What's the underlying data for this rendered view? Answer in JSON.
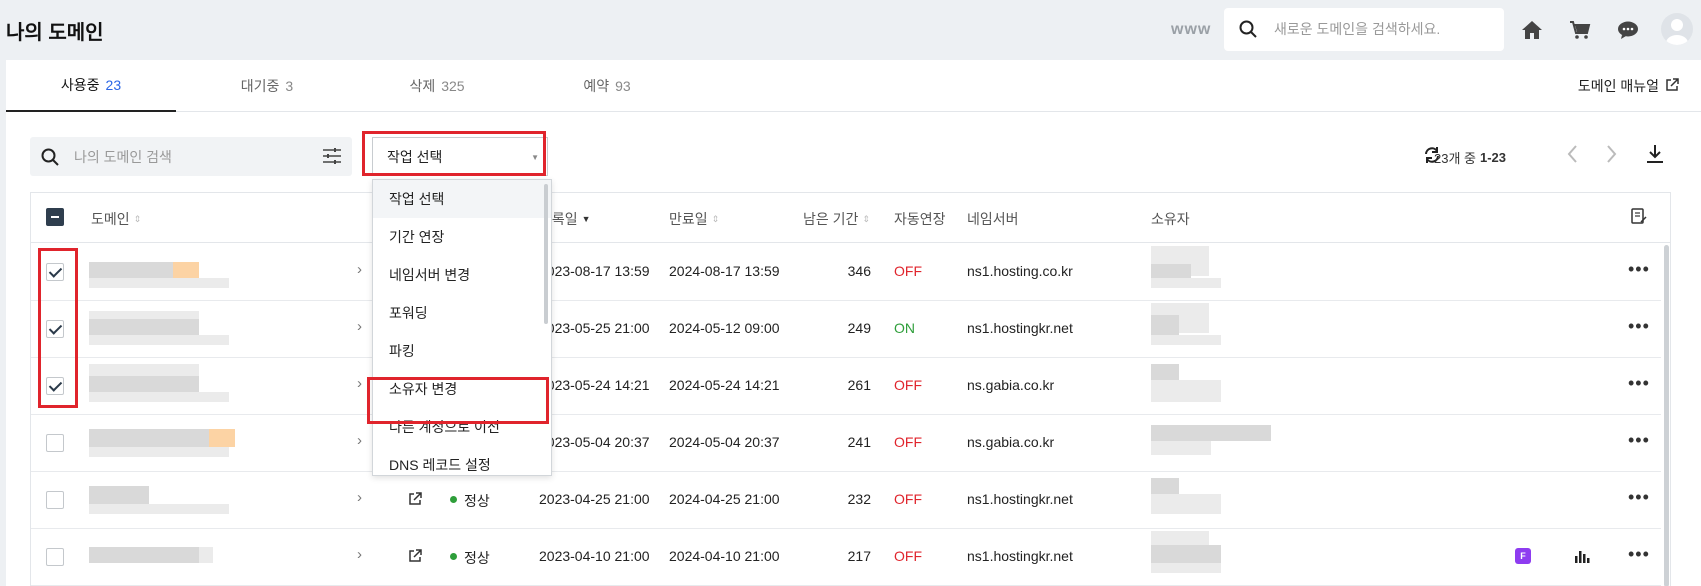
{
  "header": {
    "title": "나의 도메인",
    "www_label": "www",
    "search_placeholder": "새로운 도메인을 검색하세요.",
    "icons": [
      "home-icon",
      "cart-icon",
      "support-chat-icon",
      "user-avatar-icon"
    ]
  },
  "tabs": [
    {
      "label": "사용중",
      "count": "23",
      "active": true
    },
    {
      "label": "대기중",
      "count": "3",
      "active": false
    },
    {
      "label": "삭제",
      "count": "325",
      "active": false
    },
    {
      "label": "예약",
      "count": "93",
      "active": false
    }
  ],
  "manual_link": "도메인 매뉴얼",
  "toolbar": {
    "search_placeholder": "나의 도메인 검색",
    "action_select_value": "작업 선택",
    "pagination_prefix": "23개 중",
    "pagination_range": "1-23"
  },
  "dropdown": {
    "options": [
      "작업 선택",
      "기간 연장",
      "네임서버 변경",
      "포워딩",
      "파킹",
      "소유자 변경",
      "다른 계정으로 이전",
      "DNS 레코드 설정"
    ],
    "highlighted_option": "작업 선택",
    "emphasized_option": "소유자 변경"
  },
  "table": {
    "columns": {
      "domain": "도메인",
      "registered": "등록일",
      "expires": "만료일",
      "remaining": "남은 기간",
      "auto_renew": "자동연장",
      "nameserver": "네임서버",
      "owner": "소유자"
    },
    "rows": [
      {
        "checked": true,
        "status": "",
        "registered": "2023-08-17 13:59",
        "expires": "2024-08-17 13:59",
        "remaining": "346",
        "auto_renew": "OFF",
        "nameserver": "ns1.hosting.co.kr"
      },
      {
        "checked": true,
        "status": "",
        "registered": "2023-05-25 21:00",
        "expires": "2024-05-12 09:00",
        "remaining": "249",
        "auto_renew": "ON",
        "nameserver": "ns1.hostingkr.net"
      },
      {
        "checked": true,
        "status": "",
        "registered": "2023-05-24 14:21",
        "expires": "2024-05-24 14:21",
        "remaining": "261",
        "auto_renew": "OFF",
        "nameserver": "ns.gabia.co.kr"
      },
      {
        "checked": false,
        "status": "",
        "registered": "2023-05-04 20:37",
        "expires": "2024-05-04 20:37",
        "remaining": "241",
        "auto_renew": "OFF",
        "nameserver": "ns.gabia.co.kr"
      },
      {
        "checked": false,
        "status": "정상",
        "registered": "2023-04-25 21:00",
        "expires": "2024-04-25 21:00",
        "remaining": "232",
        "auto_renew": "OFF",
        "nameserver": "ns1.hostingkr.net"
      },
      {
        "checked": false,
        "status": "정상",
        "registered": "2023-04-10 21:00",
        "expires": "2024-04-10 21:00",
        "remaining": "217",
        "auto_renew": "OFF",
        "nameserver": "ns1.hostingkr.net"
      }
    ],
    "row6_badge": "F"
  },
  "colors": {
    "accent_blue": "#2b66e6",
    "status_green": "#2e9e3a",
    "off_red": "#e0242c",
    "highlight_red": "#e0242c",
    "badge_purple": "#8e3cf0"
  }
}
